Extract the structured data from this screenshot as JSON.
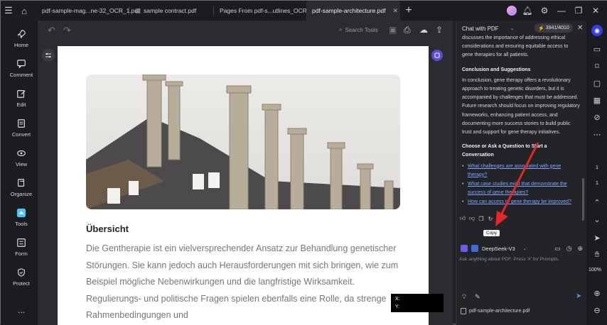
{
  "tabs": [
    {
      "label": "pdf-sample-mag...ne-32_OCR_1.pdf",
      "active": false
    },
    {
      "label": "sample contract.pdf",
      "active": false
    },
    {
      "label": "Pages From pdf-s...utlines_OCR.pdf",
      "active": false
    },
    {
      "label": "pdf-sample-architecture.pdf",
      "active": true
    }
  ],
  "sidebar": {
    "items": [
      {
        "label": "Home",
        "icon": "rocket-icon"
      },
      {
        "label": "Comment",
        "icon": "comment-icon"
      },
      {
        "label": "Edit",
        "icon": "edit-icon"
      },
      {
        "label": "Convert",
        "icon": "convert-icon"
      },
      {
        "label": "View",
        "icon": "eye-icon"
      },
      {
        "label": "Organize",
        "icon": "organize-icon"
      },
      {
        "label": "Tools",
        "icon": "tools-icon"
      },
      {
        "label": "Form",
        "icon": "form-icon"
      },
      {
        "label": "Protect",
        "icon": "shield-icon"
      }
    ],
    "more": "..."
  },
  "toolbar": {
    "search_tools": "Search Tools"
  },
  "document": {
    "heading": "Übersicht",
    "paragraph": "Die Gentherapie ist ein vielversprechender Ansatz zur Behandlung genetischer Störungen. Sie kann jedoch auch Herausforderungen mit sich bringen, wie zum Beispiel mögliche Nebenwirkungen und die langfristige Wirksamkeit. Regulierungs- und politische Fragen spielen ebenfalls eine Rolle, da strenge Rahmenbedingungen und"
  },
  "coords": {
    "x_label": "X:",
    "y_label": "Y:"
  },
  "chat": {
    "title": "Chat with PDF",
    "credits": "3941/4010",
    "intro": "discusses the importance of addressing ethical considerations and ensuring equitable access to gene therapies for all patients.",
    "conclusion_heading": "Conclusion and Suggestions",
    "conclusion_text": "In conclusion, gene therapy offers a revolutionary approach to treating genetic disorders, but it is accompanied by challenges that must be addressed. Future research should focus on improving regulatory frameworks, enhancing patient access, and documenting more success stories to build public trust and support for gene therapy initiatives.",
    "questions_heading": "Choose or Ask a Question to Start a Conversation",
    "questions": [
      "What challenges are associated with gene therapy?",
      "What case studies exist that demonstrate the success of gene therapies?",
      "How can access to gene therapy be improved?"
    ],
    "copy_tooltip": "Copy",
    "model": "DeepSeek-V3",
    "input_placeholder": "Ask anything about PDF. Press '#' for Prompts.",
    "file_name": "pdf-sample-architecture.pdf"
  },
  "rightrail": {
    "page_current": "1",
    "page_total": "1",
    "zoom": "100%"
  },
  "colors": {
    "accent": "#5b4bd6",
    "link": "#7aa8ff",
    "arrow": "#e32626"
  }
}
